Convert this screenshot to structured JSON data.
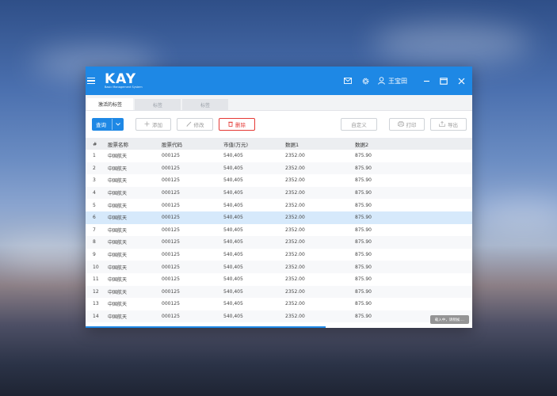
{
  "app": {
    "logo_text": "KAY",
    "logo_subtitle": "Basic Management System",
    "user_name": "王宝田"
  },
  "tabs": [
    {
      "label": "激活的标签",
      "active": true
    },
    {
      "label": "标签",
      "active": false
    },
    {
      "label": "标签",
      "active": false
    }
  ],
  "toolbar": {
    "query_label": "查询",
    "add_label": "添加",
    "edit_label": "修改",
    "delete_label": "删除",
    "custom_label": "自定义",
    "print_label": "打印",
    "export_label": "导出"
  },
  "table": {
    "columns": [
      "#",
      "股票名称",
      "股票代码",
      "市值(万元)",
      "数据1",
      "数据2"
    ],
    "rows": [
      [
        "1",
        "中国航天",
        "000125",
        "540,405",
        "2352.00",
        "875.90"
      ],
      [
        "2",
        "中国航天",
        "000125",
        "540,405",
        "2352.00",
        "875.90"
      ],
      [
        "3",
        "中国航天",
        "000125",
        "540,405",
        "2352.00",
        "875.90"
      ],
      [
        "4",
        "中国航天",
        "000125",
        "540,405",
        "2352.00",
        "875.90"
      ],
      [
        "5",
        "中国航天",
        "000125",
        "540,405",
        "2352.00",
        "875.90"
      ],
      [
        "6",
        "中国航天",
        "000125",
        "540,405",
        "2352.00",
        "875.90"
      ],
      [
        "7",
        "中国航天",
        "000125",
        "540,405",
        "2352.00",
        "875.90"
      ],
      [
        "8",
        "中国航天",
        "000125",
        "540,405",
        "2352.00",
        "875.90"
      ],
      [
        "9",
        "中国航天",
        "000125",
        "540,405",
        "2352.00",
        "875.90"
      ],
      [
        "10",
        "中国航天",
        "000125",
        "540,405",
        "2352.00",
        "875.90"
      ],
      [
        "11",
        "中国航天",
        "000125",
        "540,405",
        "2352.00",
        "875.90"
      ],
      [
        "12",
        "中国航天",
        "000125",
        "540,405",
        "2352.00",
        "875.90"
      ],
      [
        "13",
        "中国航天",
        "000125",
        "540,405",
        "2352.00",
        "875.90"
      ],
      [
        "14",
        "中国航天",
        "000125",
        "540,405",
        "2352.00",
        "875.90"
      ]
    ],
    "selected_row": 6
  },
  "status": {
    "loading_text": "载入中，请稍候....",
    "progress": 0.62
  },
  "colors": {
    "accent": "#1e88e5",
    "danger": "#e53935",
    "selected_row": "#d6e9fb"
  }
}
